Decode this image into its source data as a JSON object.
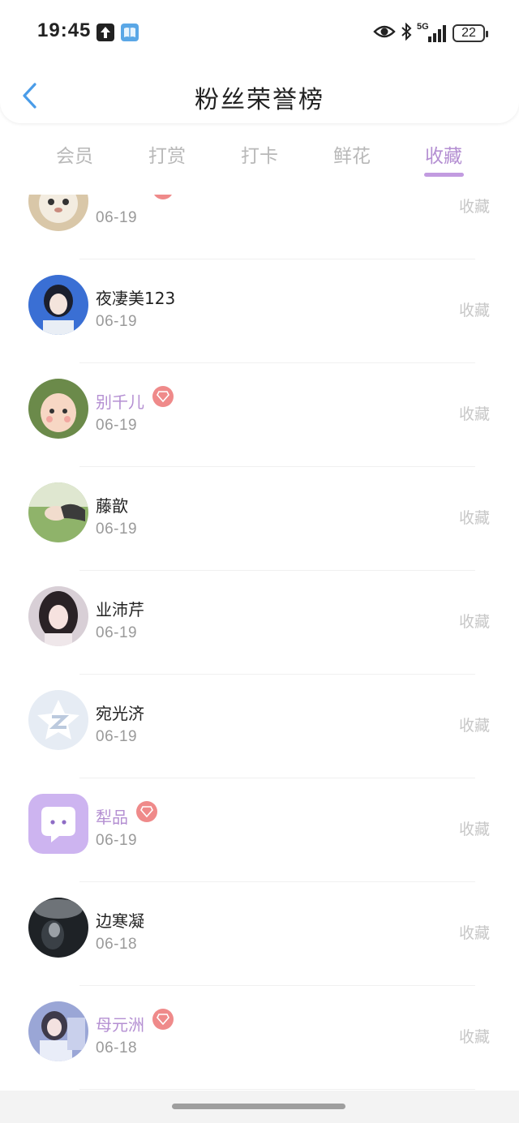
{
  "status_bar": {
    "time": "19:45",
    "network": "5G",
    "battery": "22"
  },
  "header": {
    "title": "粉丝荣誉榜",
    "back_icon": "chevron-left-icon",
    "accent_color": "#4a9ce8"
  },
  "tabs": [
    {
      "label": "会员",
      "active": false
    },
    {
      "label": "打赏",
      "active": false
    },
    {
      "label": "打卡",
      "active": false
    },
    {
      "label": "鲜花",
      "active": false
    },
    {
      "label": "收藏",
      "active": true
    }
  ],
  "colors": {
    "active_tab": "#b48fd2",
    "vip_name": "#b48fd2",
    "badge": "#ef8a8a"
  },
  "fans": [
    {
      "name": "",
      "date": "06-19",
      "action": "收藏",
      "vip": true,
      "avatar": "cat-photo"
    },
    {
      "name": "夜凄美123",
      "date": "06-19",
      "action": "收藏",
      "vip": false,
      "avatar": "girl-short-hair"
    },
    {
      "name": "别千儿",
      "date": "06-19",
      "action": "收藏",
      "vip": true,
      "avatar": "child-green-hat"
    },
    {
      "name": "藤歆",
      "date": "06-19",
      "action": "收藏",
      "vip": false,
      "avatar": "grass-photo"
    },
    {
      "name": "业沛芹",
      "date": "06-19",
      "action": "收藏",
      "vip": false,
      "avatar": "girl-long-hair"
    },
    {
      "name": "宛光济",
      "date": "06-19",
      "action": "收藏",
      "vip": false,
      "avatar": "default-star-logo"
    },
    {
      "name": "犁品",
      "date": "06-19",
      "action": "收藏",
      "vip": true,
      "avatar": "chat-bubble-logo"
    },
    {
      "name": "边寒凝",
      "date": "06-18",
      "action": "收藏",
      "vip": false,
      "avatar": "dark-rain-photo"
    },
    {
      "name": "母元洲",
      "date": "06-18",
      "action": "收藏",
      "vip": true,
      "avatar": "girl-blue-photo"
    }
  ]
}
